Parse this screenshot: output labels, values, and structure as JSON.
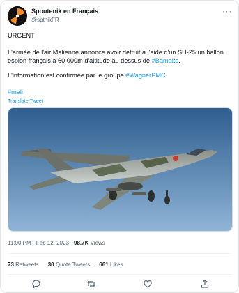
{
  "account": {
    "name": "Spoutenik en Français",
    "handle": "@sptnikFR"
  },
  "tweet": {
    "line1": "URGENT",
    "para2_part1": "L'armée de l'air Malienne annonce avoir détruit à l'aide d'un SU-25 un ballon espion français à 60 000m d'altitude au dessus de ",
    "para2_link": "#Bamako",
    "para2_end": ".",
    "para3_part1": "L'information est confirmée par le groupe ",
    "para3_link": "#WagnerPMC",
    "hashtag": "#mali",
    "translate": "Translate Tweet"
  },
  "meta": {
    "time": "11:00 PM · Feb 12, 2023",
    "separator": " · ",
    "views_count": "98.7K",
    "views_label": " Views"
  },
  "stats": {
    "retweets_count": "73",
    "retweets_label": " Retweets",
    "quotes_count": "30",
    "quotes_label": " Quote Tweets",
    "likes_count": "661",
    "likes_label": " Likes"
  },
  "icons": {
    "more": "more-dots-icon",
    "reply": "reply-icon",
    "retweet": "retweet-icon",
    "like": "heart-icon",
    "share": "share-icon"
  },
  "colors": {
    "link": "#1d9bf0",
    "text": "#0f1419",
    "muted": "#536471",
    "sky_top": "#2e5e8f",
    "sky_bottom": "#8fb4d6"
  }
}
